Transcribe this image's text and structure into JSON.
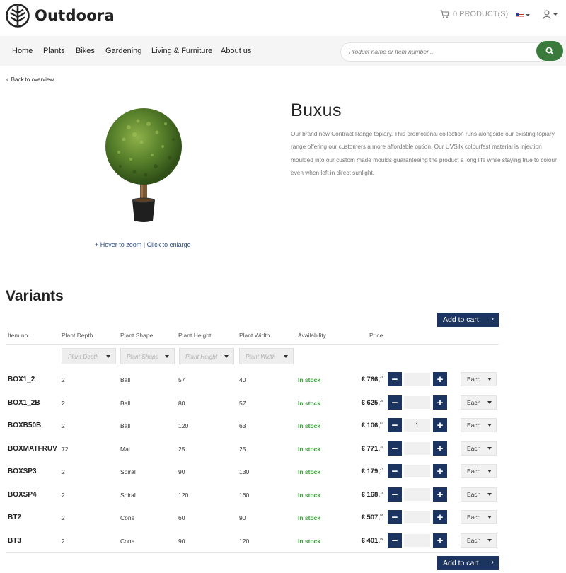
{
  "header": {
    "brand": "Outdoora",
    "cart_label": "0 PRODUCT(S)",
    "language_icon": "us-flag-icon",
    "user_icon": "user-icon"
  },
  "nav": {
    "items": [
      "Home",
      "Plants",
      "Bikes",
      "Gardening",
      "Living & Furniture",
      "About us"
    ],
    "search_placeholder": "Product name or Item number...",
    "search_icon": "search-icon"
  },
  "back_label": "Back to overview",
  "product": {
    "title": "Buxus",
    "description": "Our brand new Contract Range topiary. This promotional collection runs alongside our existing topiary range offering our customers a more affordable option. Our UVSilx colourfast material is injection moulded into our custom made moulds guaranteeing the product a long life while staying true to colour even when left in direct sunlight.",
    "zoom_hint": "+ Hover to zoom | Click to enlarge"
  },
  "variants": {
    "title": "Variants",
    "add_to_cart_label": "Add to cart",
    "columns": [
      "Item no.",
      "Plant Depth",
      "Plant Shape",
      "Plant Height",
      "Plant Width",
      "Availability",
      "Price"
    ],
    "filters": [
      "Plant Depth",
      "Plant Shape",
      "Plant Height",
      "Plant Width"
    ],
    "rows": [
      {
        "item": "BOX1_2",
        "depth": "2",
        "shape": "Ball",
        "height": "57",
        "width": "40",
        "availability": "In stock",
        "price_main": "€ 766,",
        "price_cents": "49",
        "qty": "",
        "unit": "Each"
      },
      {
        "item": "BOX1_2B",
        "depth": "2",
        "shape": "Ball",
        "height": "80",
        "width": "57",
        "availability": "In stock",
        "price_main": "€ 625,",
        "price_cents": "38",
        "qty": "",
        "unit": "Each"
      },
      {
        "item": "BOXB50B",
        "depth": "2",
        "shape": "Ball",
        "height": "120",
        "width": "63",
        "availability": "In stock",
        "price_main": "€ 106,",
        "price_cents": "84",
        "qty": "1",
        "unit": "Each"
      },
      {
        "item": "BOXMATFRUV",
        "depth": "72",
        "shape": "Mat",
        "height": "25",
        "width": "25",
        "availability": "In stock",
        "price_main": "€ 771,",
        "price_cents": "16",
        "qty": "",
        "unit": "Each"
      },
      {
        "item": "BOXSP3",
        "depth": "2",
        "shape": "Spiral",
        "height": "90",
        "width": "130",
        "availability": "In stock",
        "price_main": "€ 179,",
        "price_cents": "42",
        "qty": "",
        "unit": "Each"
      },
      {
        "item": "BOXSP4",
        "depth": "2",
        "shape": "Spiral",
        "height": "120",
        "width": "160",
        "availability": "In stock",
        "price_main": "€ 168,",
        "price_cents": "78",
        "qty": "",
        "unit": "Each"
      },
      {
        "item": "BT2",
        "depth": "2",
        "shape": "Cone",
        "height": "60",
        "width": "90",
        "availability": "In stock",
        "price_main": "€ 507,",
        "price_cents": "95",
        "qty": "",
        "unit": "Each"
      },
      {
        "item": "BT3",
        "depth": "2",
        "shape": "Cone",
        "height": "90",
        "width": "120",
        "availability": "In stock",
        "price_main": "€ 401,",
        "price_cents": "05",
        "qty": "",
        "unit": "Each"
      }
    ]
  },
  "colors": {
    "primary_navy": "#1b3560",
    "search_green": "#3a7a3c",
    "in_stock_green": "#3aa13a",
    "link_blue": "#2a4a7f"
  }
}
